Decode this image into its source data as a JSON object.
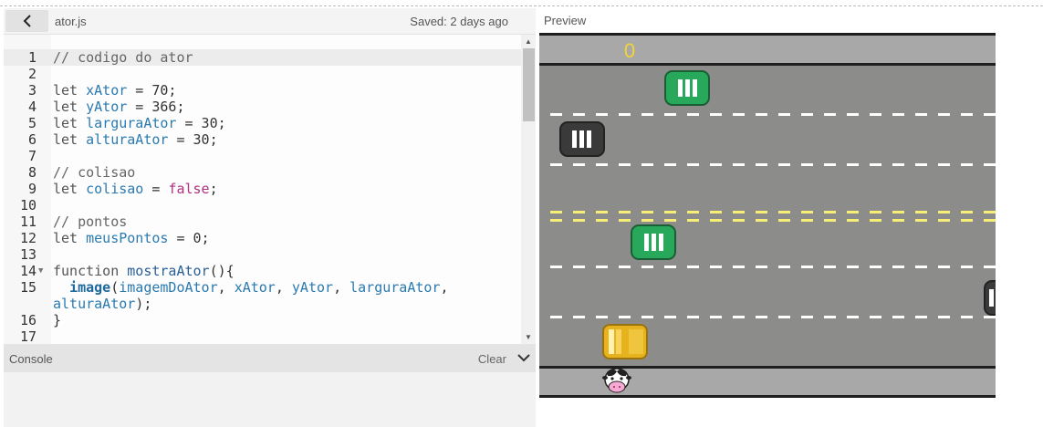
{
  "header": {
    "file_name": "ator.js",
    "saved": "Saved: 2 days ago",
    "back_icon": "chevron-left-icon"
  },
  "editor": {
    "lines": [
      {
        "n": "",
        "t": ""
      },
      {
        "n": "1",
        "t": "// codigo do ator",
        "active": true
      },
      {
        "n": "2",
        "t": ""
      },
      {
        "n": "3",
        "t": "let xAtor = 70;"
      },
      {
        "n": "4",
        "t": "let yAtor = 366;"
      },
      {
        "n": "5",
        "t": "let larguraAtor = 30;"
      },
      {
        "n": "6",
        "t": "let alturaAtor = 30;"
      },
      {
        "n": "7",
        "t": ""
      },
      {
        "n": "8",
        "t": "// colisao"
      },
      {
        "n": "9",
        "t": "let colisao = false;"
      },
      {
        "n": "10",
        "t": ""
      },
      {
        "n": "11",
        "t": "// pontos"
      },
      {
        "n": "12",
        "t": "let meusPontos = 0;"
      },
      {
        "n": "13",
        "t": ""
      },
      {
        "n": "14",
        "t": "function mostraAtor(){",
        "fold": true
      },
      {
        "n": "15",
        "t": "  image(imagemDoAtor, xAtor, yAtor, larguraAtor,"
      },
      {
        "n": "",
        "t": "alturaAtor);"
      },
      {
        "n": "16",
        "t": "}"
      },
      {
        "n": "17",
        "t": ""
      }
    ]
  },
  "console": {
    "label": "Console",
    "clear_label": "Clear",
    "toggle_icon": "chevron-down-icon"
  },
  "preview": {
    "label": "Preview",
    "score": "0",
    "colors": {
      "road": "#8c8c8a",
      "sidewalk": "#a8a8a8",
      "border": "#1e1e1e",
      "lane": "#ffffff",
      "center": "#f7ee76",
      "score": "#f2d43a"
    },
    "cars": [
      {
        "color": "green",
        "hex": "#27a85a",
        "dir": "right"
      },
      {
        "color": "black",
        "hex": "#3a3a3a",
        "dir": "left"
      },
      {
        "color": "green",
        "hex": "#27a85a",
        "dir": "right"
      },
      {
        "color": "black",
        "hex": "#3a3a3a",
        "dir": "left"
      },
      {
        "color": "yellow",
        "hex": "#e6b31e",
        "dir": "left"
      }
    ],
    "actor": "cow-actor"
  }
}
